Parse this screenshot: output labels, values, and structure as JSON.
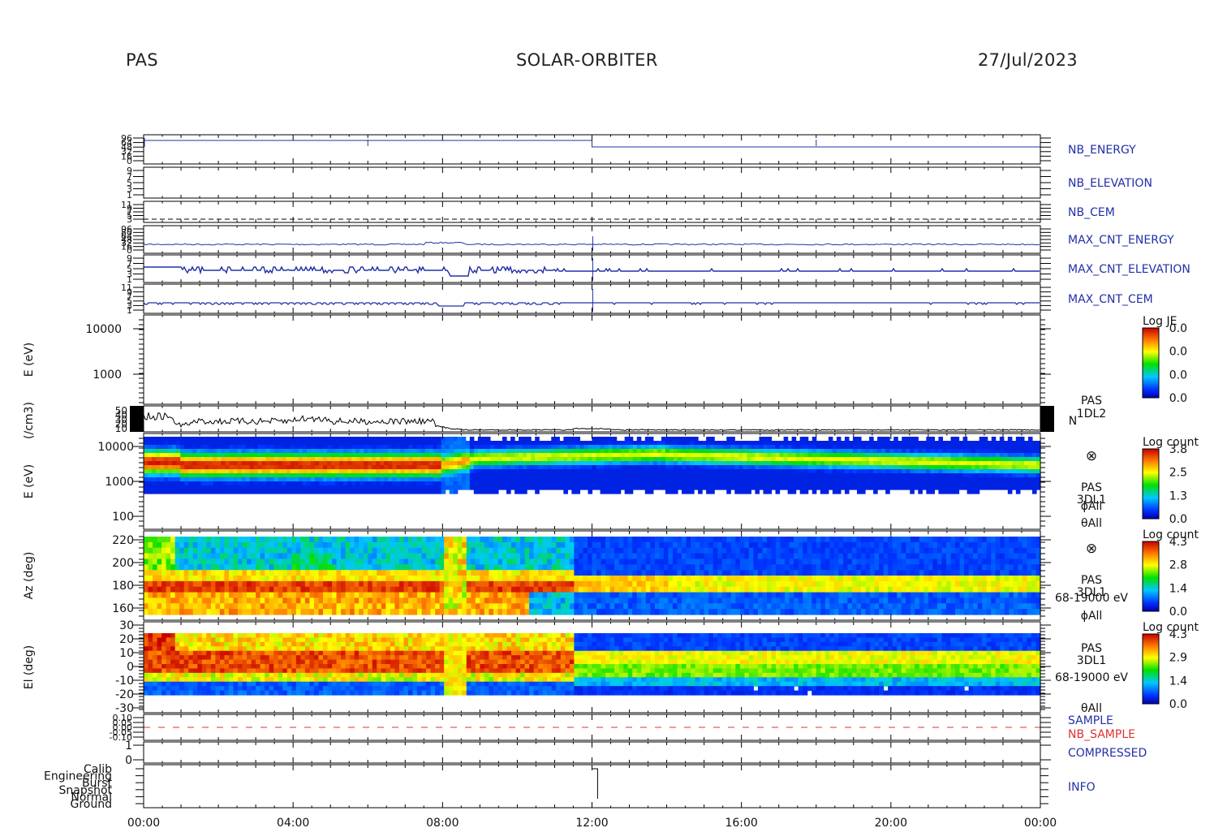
{
  "header": {
    "left": "PAS",
    "center": "SOLAR-ORBITER",
    "right": "27/Jul/2023"
  },
  "colors": {
    "blue": "#2230a8",
    "red": "#e03030",
    "black": "#000000"
  },
  "chart_data": {
    "type": "heatmap",
    "x_ticks": [
      "00:00",
      "04:00",
      "08:00",
      "12:00",
      "16:00",
      "20:00",
      "00:00"
    ],
    "x_range_hours": [
      0,
      24
    ],
    "panels": [
      {
        "id": "nb_energy",
        "type": "line",
        "label_right": "NB_ENERGY",
        "color": "#2230a8",
        "ytick_labels": [
          "96",
          "64",
          "48",
          "32",
          "16",
          "0"
        ]
      },
      {
        "id": "nb_elevation",
        "type": "line",
        "label_right": "NB_ELEVATION",
        "color": "#2230a8",
        "ytick_labels": [
          "9",
          "7",
          "5",
          "3",
          "1"
        ]
      },
      {
        "id": "nb_cem",
        "type": "line",
        "label_right": "NB_CEM",
        "color": "#2230a8",
        "ytick_labels": [
          "11",
          "9",
          "7",
          "5",
          "3"
        ],
        "value": 9
      },
      {
        "id": "max_cnt_energy",
        "type": "line",
        "label_right": "MAX_CNT_ENERGY",
        "color": "#2230a8",
        "ytick_labels": [
          "96",
          "80",
          "64",
          "48",
          "32",
          "16",
          "0"
        ]
      },
      {
        "id": "max_cnt_elevation",
        "type": "line",
        "label_right": "MAX_CNT_ELEVATION",
        "color": "#2230a8",
        "ytick_labels": [
          "9",
          "7",
          "5",
          "3",
          "1"
        ]
      },
      {
        "id": "max_cnt_cem",
        "type": "line",
        "label_right": "MAX_CNT_CEM",
        "color": "#2230a8",
        "ytick_labels": [
          "11",
          "9",
          "7",
          "5",
          "3",
          "1"
        ]
      },
      {
        "id": "je",
        "type": "heatmap",
        "ylabel": "E (eV)",
        "ytick_labels": [
          "10000",
          "1000"
        ],
        "colorbar": {
          "title": "Log JE",
          "ticks": [
            "0.0",
            "0.0",
            "0.0",
            "0.0"
          ]
        }
      },
      {
        "id": "density",
        "type": "line",
        "ylabel": "(/cm3)",
        "ytick_labels": [
          "50",
          "40",
          "30",
          "20",
          "10"
        ],
        "side_labels": [
          "PAS",
          "1DL2",
          "N"
        ]
      },
      {
        "id": "energy_spec",
        "type": "heatmap",
        "ylabel": "E (eV)",
        "ytick_labels": [
          "10000",
          "1000",
          "100"
        ],
        "colorbar": {
          "title": "Log count",
          "ticks": [
            "3.8",
            "2.5",
            "1.3",
            "0.0"
          ]
        },
        "side_labels": [
          "⊗",
          "PAS",
          "3DL1",
          "ϕAll",
          "θAll"
        ]
      },
      {
        "id": "azimuth",
        "type": "heatmap",
        "ylabel": "Az (deg)",
        "ytick_labels": [
          "220",
          "200",
          "180",
          "160"
        ],
        "colorbar": {
          "title": "Log count",
          "ticks": [
            "4.3",
            "2.8",
            "1.4",
            "0.0"
          ]
        },
        "side_labels": [
          "⊗",
          "PAS",
          "3DL1",
          "68-19000 eV",
          "ϕAll"
        ]
      },
      {
        "id": "elevation",
        "type": "heatmap",
        "ylabel": "El (deg)",
        "ytick_labels": [
          "30",
          "20",
          "10",
          "0",
          "-10",
          "-20",
          "-30"
        ],
        "colorbar": {
          "title": "Log count",
          "ticks": [
            "4.3",
            "2.9",
            "1.4",
            "0.0"
          ]
        },
        "side_labels": [
          "PAS",
          "3DL1",
          "68-19000 eV",
          "θAll"
        ]
      },
      {
        "id": "sample",
        "type": "line",
        "label_right": "SAMPLE",
        "label_right_2": "NB_SAMPLE",
        "ytick_labels": [
          "0.10",
          "0.05",
          "0.00",
          "-0.05",
          "-0.10"
        ],
        "colors": [
          "#2230a8",
          "#e03030"
        ]
      },
      {
        "id": "compressed",
        "type": "line",
        "label_right": "COMPRESSED",
        "color": "#2230a8",
        "ytick_labels": [
          "1",
          "0"
        ]
      },
      {
        "id": "info",
        "type": "line",
        "label_right": "INFO",
        "color": "#2230a8",
        "ytick_labels": [
          "Calib",
          "Engineering",
          "Burst",
          "Snapshot",
          "Normal",
          "Ground"
        ]
      }
    ]
  }
}
